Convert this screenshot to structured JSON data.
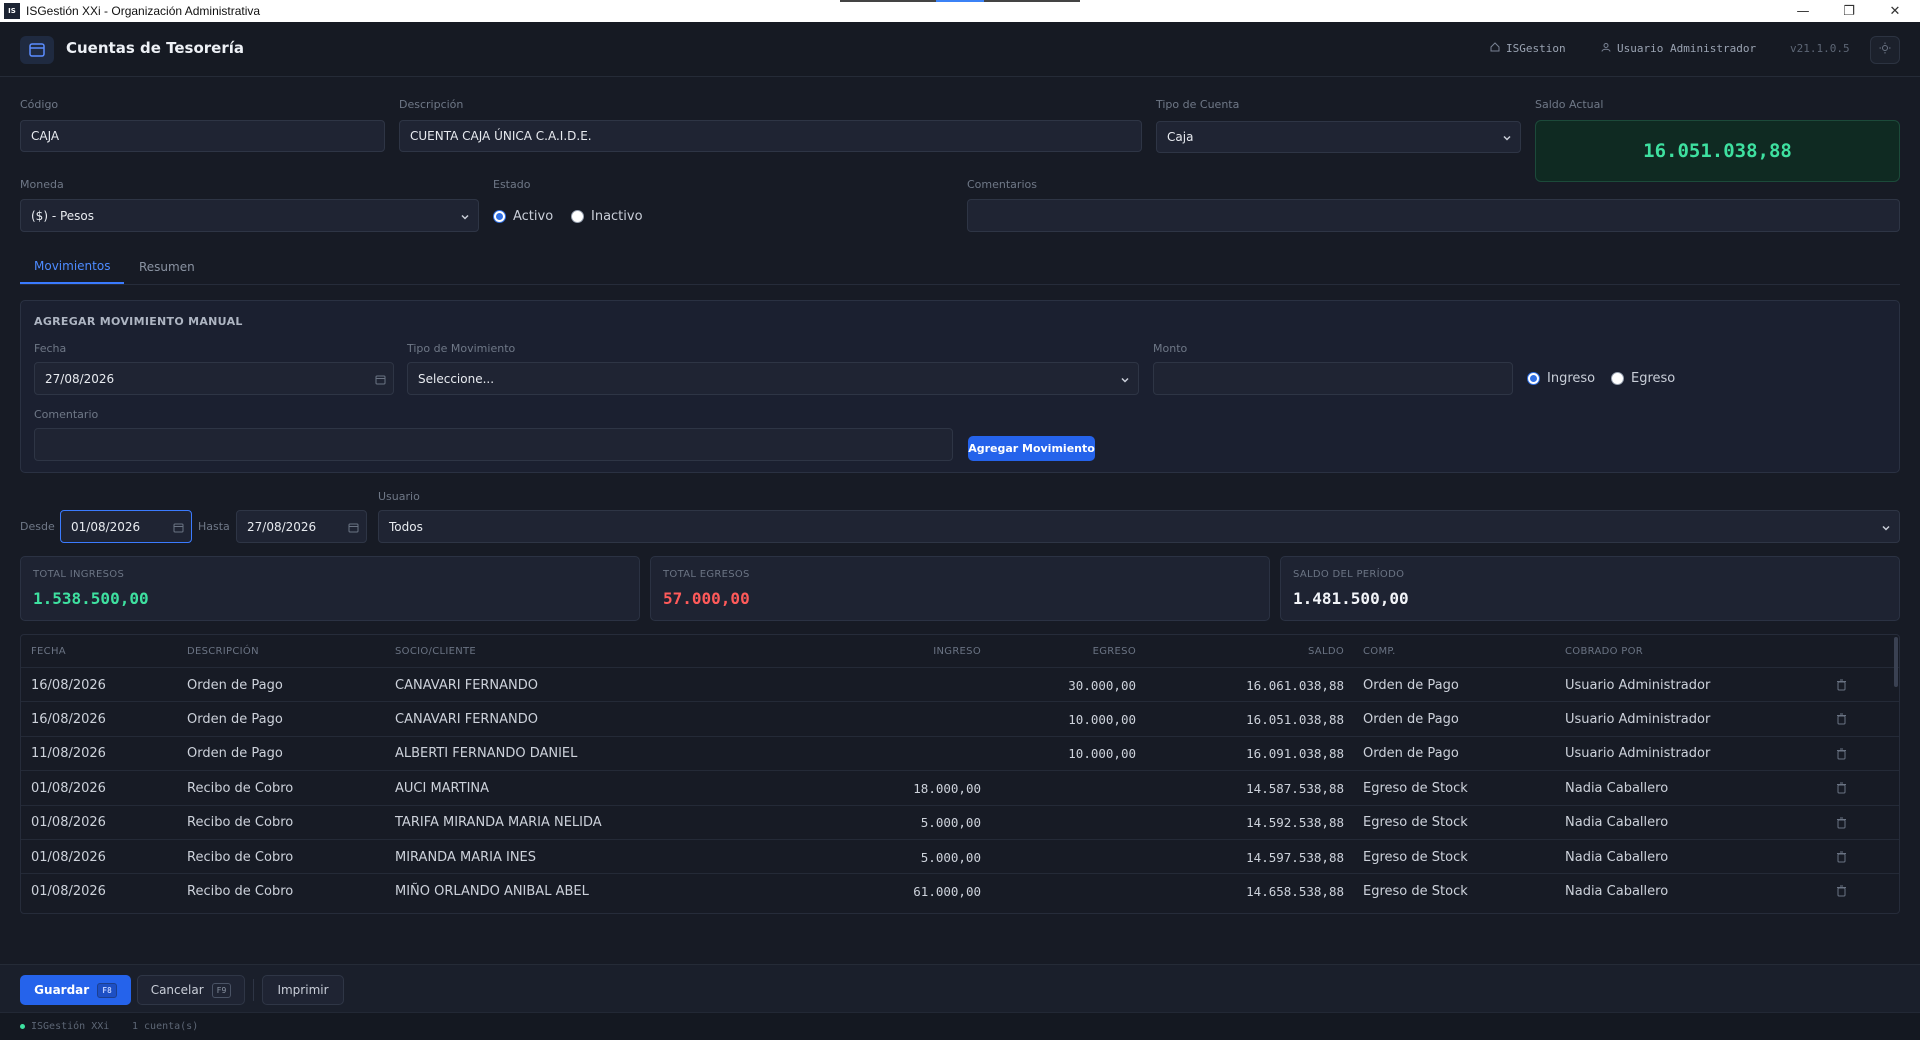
{
  "window": {
    "title": "ISGestión XXi - Organización Administrativa",
    "icon_text": "IS"
  },
  "header": {
    "title": "Cuentas de Tesorería",
    "company": "ISGestion",
    "user": "Usuario Administrador",
    "version": "v21.1.0.5"
  },
  "form": {
    "codigo_label": "Código",
    "codigo_value": "CAJA",
    "descripcion_label": "Descripción",
    "descripcion_value": "CUENTA CAJA ÚNICA C.A.I.D.E.",
    "tipo_label": "Tipo de Cuenta",
    "tipo_value": "Caja",
    "saldo_label": "Saldo Actual",
    "saldo_value": "16.051.038,88",
    "moneda_label": "Moneda",
    "moneda_value": "($) - Pesos",
    "estado_label": "Estado",
    "estado_activo": "Activo",
    "estado_inactivo": "Inactivo",
    "comentarios_label": "Comentarios",
    "comentarios_value": ""
  },
  "tabs": [
    {
      "label": "Movimientos"
    },
    {
      "label": "Resumen"
    }
  ],
  "manual": {
    "title": "AGREGAR MOVIMIENTO MANUAL",
    "fecha_label": "Fecha",
    "fecha_value": "27/08/2026",
    "tipo_label": "Tipo de Movimiento",
    "tipo_value": "Seleccione...",
    "monto_label": "Monto",
    "monto_value": "",
    "ingreso": "Ingreso",
    "egreso": "Egreso",
    "comentario_label": "Comentario",
    "add_button": "Agregar Movimiento"
  },
  "filters": {
    "desde_label": "Desde",
    "desde_value": "01/08/2026",
    "hasta_label": "Hasta",
    "hasta_value": "27/08/2026",
    "usuario_label": "Usuario",
    "usuario_value": "Todos"
  },
  "summary": {
    "ingresos_label": "TOTAL INGRESOS",
    "ingresos_value": "1.538.500,00",
    "ingresos_color": "#3ee0a0",
    "egresos_label": "TOTAL EGRESOS",
    "egresos_value": "57.000,00",
    "egresos_color": "#ff5a5a",
    "periodo_label": "SALDO DEL PERÍODO",
    "periodo_value": "1.481.500,00"
  },
  "table": {
    "headers": {
      "fecha": "FECHA",
      "descripcion": "DESCRIPCIÓN",
      "socio": "SOCIO/CLIENTE",
      "ingreso": "INGRESO",
      "egreso": "EGRESO",
      "saldo": "SALDO",
      "comp": "COMP.",
      "cobrado": "COBRADO POR"
    },
    "rows": [
      {
        "fecha": "16/08/2026",
        "descripcion": "Orden de Pago",
        "socio": "CANAVARI FERNANDO",
        "ingreso": "",
        "egreso": "30.000,00",
        "saldo": "16.061.038,88",
        "comp": "Orden de Pago",
        "cobrado": "Usuario Administrador"
      },
      {
        "fecha": "16/08/2026",
        "descripcion": "Orden de Pago",
        "socio": "CANAVARI FERNANDO",
        "ingreso": "",
        "egreso": "10.000,00",
        "saldo": "16.051.038,88",
        "comp": "Orden de Pago",
        "cobrado": "Usuario Administrador"
      },
      {
        "fecha": "11/08/2026",
        "descripcion": "Orden de Pago",
        "socio": "ALBERTI FERNANDO DANIEL",
        "ingreso": "",
        "egreso": "10.000,00",
        "saldo": "16.091.038,88",
        "comp": "Orden de Pago",
        "cobrado": "Usuario Administrador"
      },
      {
        "fecha": "01/08/2026",
        "descripcion": "Recibo de Cobro",
        "socio": "AUCI MARTINA",
        "ingreso": "18.000,00",
        "egreso": "",
        "saldo": "14.587.538,88",
        "comp": "Egreso de Stock",
        "cobrado": "Nadia Caballero"
      },
      {
        "fecha": "01/08/2026",
        "descripcion": "Recibo de Cobro",
        "socio": "TARIFA MIRANDA MARIA NELIDA",
        "ingreso": "5.000,00",
        "egreso": "",
        "saldo": "14.592.538,88",
        "comp": "Egreso de Stock",
        "cobrado": "Nadia Caballero"
      },
      {
        "fecha": "01/08/2026",
        "descripcion": "Recibo de Cobro",
        "socio": "MIRANDA MARIA INES",
        "ingreso": "5.000,00",
        "egreso": "",
        "saldo": "14.597.538,88",
        "comp": "Egreso de Stock",
        "cobrado": "Nadia Caballero"
      },
      {
        "fecha": "01/08/2026",
        "descripcion": "Recibo de Cobro",
        "socio": "MIÑO ORLANDO ANIBAL ABEL",
        "ingreso": "61.000,00",
        "egreso": "",
        "saldo": "14.658.538,88",
        "comp": "Egreso de Stock",
        "cobrado": "Nadia Caballero"
      }
    ]
  },
  "footer": {
    "guardar": "Guardar",
    "guardar_key": "F8",
    "cancelar": "Cancelar",
    "cancelar_key": "F9",
    "imprimir": "Imprimir"
  },
  "status": {
    "app": "ISGestión XXi",
    "count": "1 cuenta(s)"
  }
}
